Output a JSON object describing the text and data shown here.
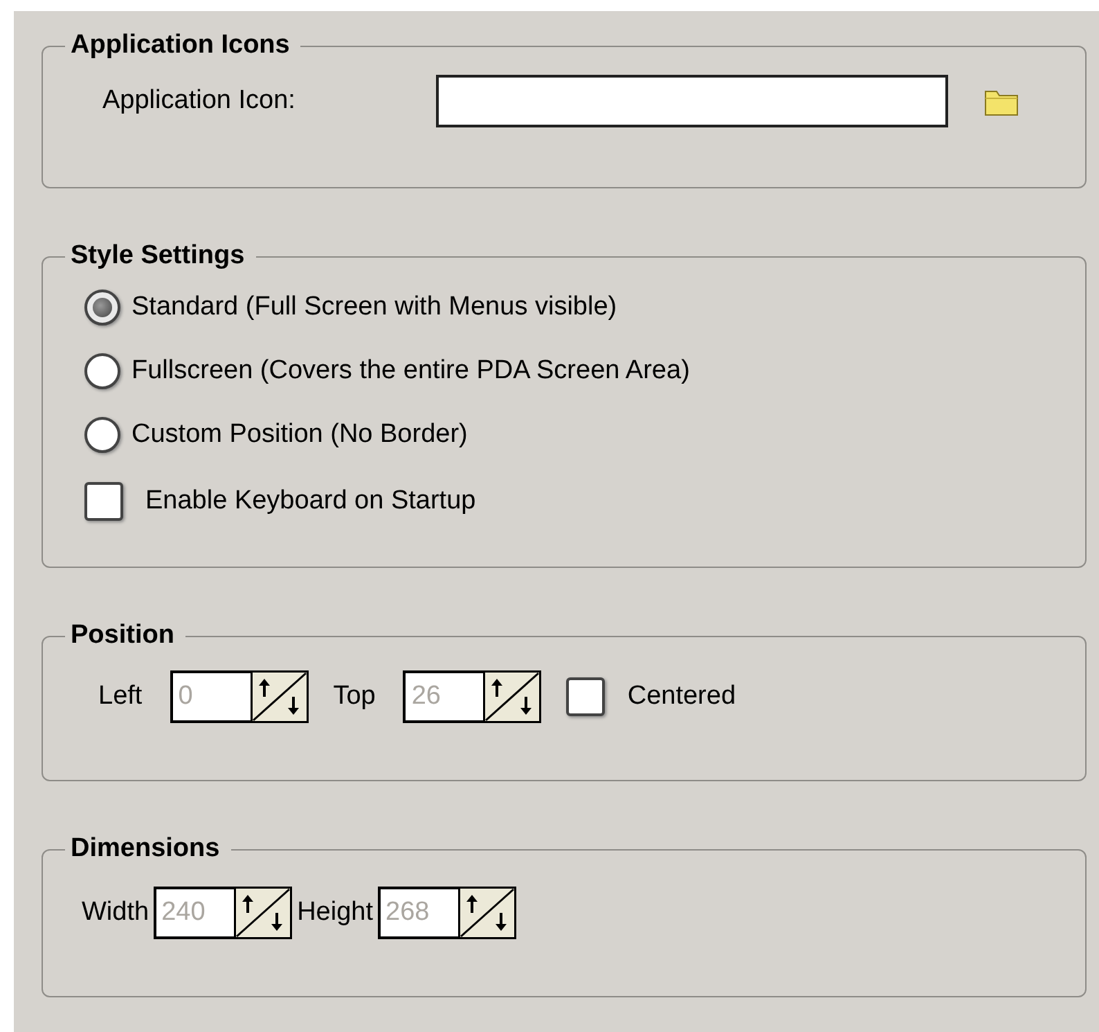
{
  "application_icons": {
    "title": "Application Icons",
    "label": "Application Icon:"
  },
  "style_settings": {
    "title": "Style Settings",
    "options": [
      {
        "label": "Standard (Full Screen with Menus visible)",
        "selected": true
      },
      {
        "label": "Fullscreen (Covers the entire PDA Screen Area)",
        "selected": false
      },
      {
        "label": "Custom Position (No Border)",
        "selected": false
      }
    ],
    "keyboard": {
      "label": "Enable Keyboard on Startup",
      "checked": false
    }
  },
  "position": {
    "title": "Position",
    "fields": [
      {
        "label": "Left",
        "value": "0",
        "disabled": true
      },
      {
        "label": "Top",
        "value": "26",
        "disabled": true
      }
    ],
    "centered": {
      "label": "Centered",
      "checked": false
    }
  },
  "dimensions": {
    "title": "Dimensions",
    "fields": [
      {
        "label": "Width",
        "value": "240",
        "disabled": true
      },
      {
        "label": "Height",
        "value": "268",
        "disabled": true
      }
    ]
  }
}
